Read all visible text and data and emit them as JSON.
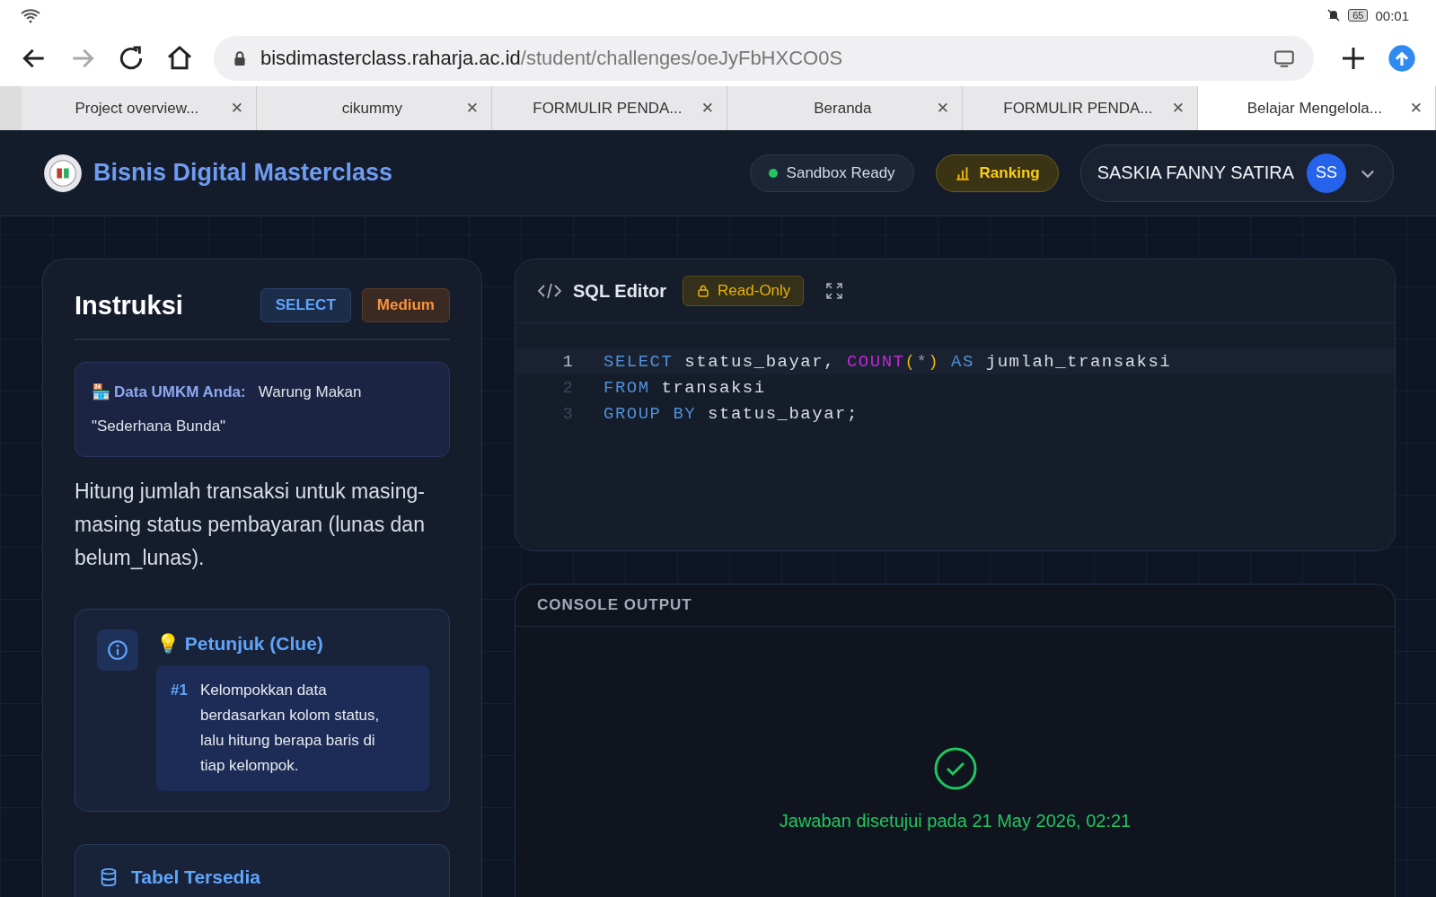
{
  "status_bar": {
    "battery": "65",
    "time": "00:01"
  },
  "browser": {
    "url_host": "bisdimasterclass.raharja.ac.id",
    "url_path": "/student/challenges/oeJyFbHXCO0S",
    "tabs": [
      {
        "label": "Project overview...",
        "selected": false
      },
      {
        "label": "cikummy",
        "selected": false
      },
      {
        "label": "FORMULIR PENDA...",
        "selected": false
      },
      {
        "label": "Beranda",
        "selected": false
      },
      {
        "label": "FORMULIR PENDA...",
        "selected": false
      },
      {
        "label": "Belajar Mengelola...",
        "selected": true
      }
    ],
    "tab_close": "✕"
  },
  "header": {
    "title": "Bisnis Digital Masterclass",
    "sandbox": "Sandbox Ready",
    "ranking": "Ranking",
    "user": "SASKIA FANNY SATIRA",
    "initials": "SS"
  },
  "instructions": {
    "title": "Instruksi",
    "tags": [
      {
        "label": "SELECT",
        "kind": "type"
      },
      {
        "label": "Medium",
        "kind": "difficulty"
      }
    ],
    "umkm_icon": "🏪",
    "umkm_label": "Data UMKM Anda:",
    "umkm_value": "Warung Makan \"Sederhana Bunda\"",
    "task": "Hitung jumlah transaksi untuk masing-masing status pembayaran (lunas dan belum_lunas).",
    "clue_title": "💡 Petunjuk (Clue)",
    "clues": [
      {
        "number": "#1",
        "text": "Kelompokkan data berdasarkan kolom status, lalu hitung berapa baris di tiap kelompok."
      }
    ],
    "tables_title": "Tabel Tersedia"
  },
  "editor": {
    "title": "SQL Editor",
    "badge": "Read-Only",
    "lines": [
      {
        "number": "1",
        "active": true,
        "tokens": [
          {
            "text": "SELECT",
            "kind": "keyword"
          },
          {
            "text": " status_bayar, ",
            "kind": "plain"
          },
          {
            "text": "COUNT",
            "kind": "function"
          },
          {
            "text": "(",
            "kind": "paren"
          },
          {
            "text": "*",
            "kind": "op"
          },
          {
            "text": ")",
            "kind": "paren"
          },
          {
            "text": " AS",
            "kind": "keyword"
          },
          {
            "text": " jumlah_transaksi",
            "kind": "plain"
          }
        ]
      },
      {
        "number": "2",
        "active": false,
        "tokens": [
          {
            "text": "FROM",
            "kind": "keyword"
          },
          {
            "text": " transaksi",
            "kind": "plain"
          }
        ]
      },
      {
        "number": "3",
        "active": false,
        "tokens": [
          {
            "text": "GROUP BY",
            "kind": "keyword"
          },
          {
            "text": " status_bayar;",
            "kind": "plain"
          }
        ]
      }
    ]
  },
  "console": {
    "title": "CONSOLE OUTPUT",
    "message": "Jawaban disetujui pada 21 May 2026, 02:21"
  }
}
